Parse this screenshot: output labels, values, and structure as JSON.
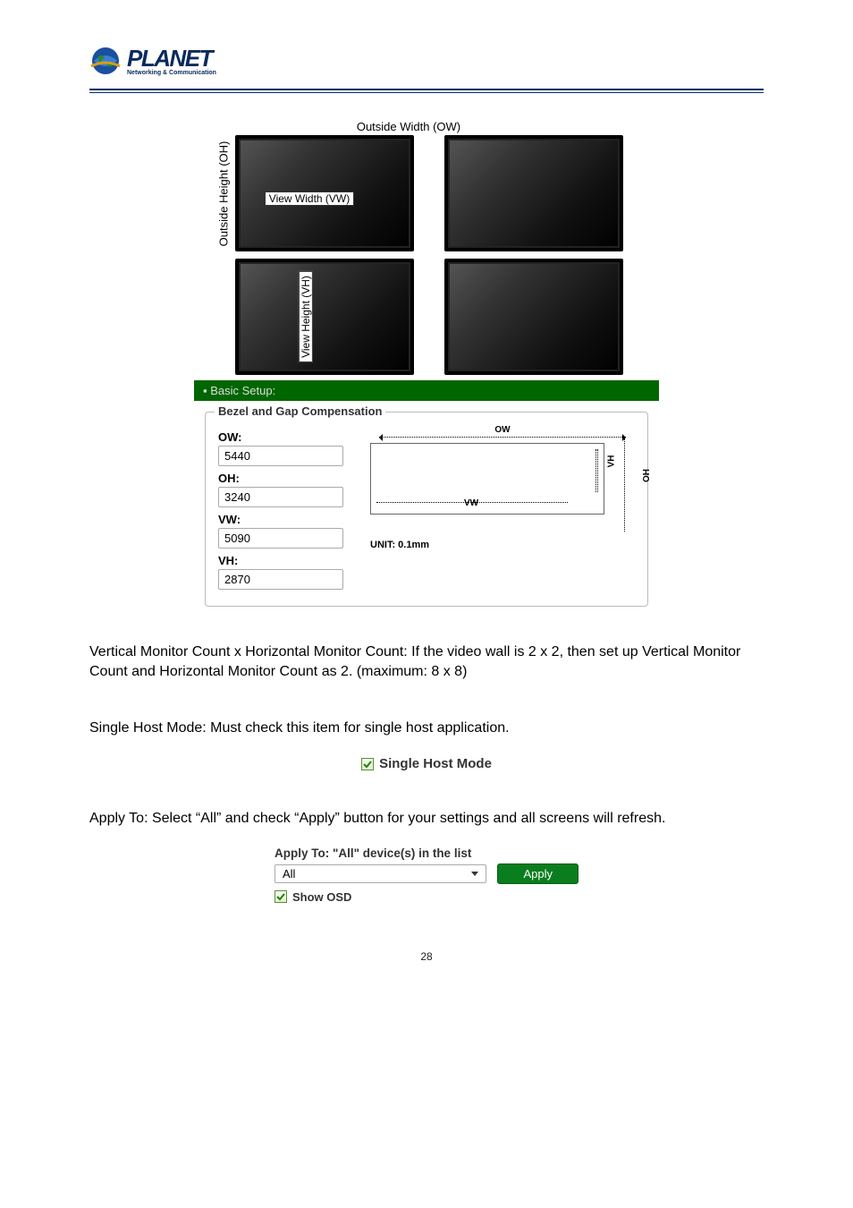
{
  "logo": {
    "main": "PLANET",
    "sub": "Networking & Communication"
  },
  "monitor_diagram": {
    "outside_width": "Outside Width (OW)",
    "outside_height": "Outside Height (OH)",
    "view_width": "View Width (VW)",
    "view_height": "View Height (VH)"
  },
  "setup": {
    "tab_label": "Basic Setup:",
    "fieldset_title": "Bezel and Gap Compensation",
    "ow": {
      "label": "OW:",
      "value": "5440"
    },
    "oh": {
      "label": "OH:",
      "value": "3240"
    },
    "vw": {
      "label": "VW:",
      "value": "5090"
    },
    "vh": {
      "label": "VH:",
      "value": "2870"
    },
    "diag": {
      "ow": "OW",
      "oh": "OH",
      "vw": "VW",
      "vh": "VH",
      "unit": "UNIT: 0.1mm"
    }
  },
  "para1": "Vertical Monitor Count x Horizontal Monitor Count: If the video wall is 2 x 2, then set up Vertical Monitor Count and Horizontal Monitor Count as 2. (maximum: 8 x 8)",
  "para2": "Single Host Mode: Must check this item for single host application.",
  "single_host_mode_label": "Single Host Mode",
  "para3": "Apply To: Select “All” and check “Apply” button for your settings and all screens will refresh.",
  "apply_block": {
    "title": "Apply To: \"All\" device(s) in the list",
    "selected": "All",
    "apply_label": "Apply",
    "show_osd_label": "Show OSD"
  },
  "bullet": "▪",
  "page_number": "28"
}
